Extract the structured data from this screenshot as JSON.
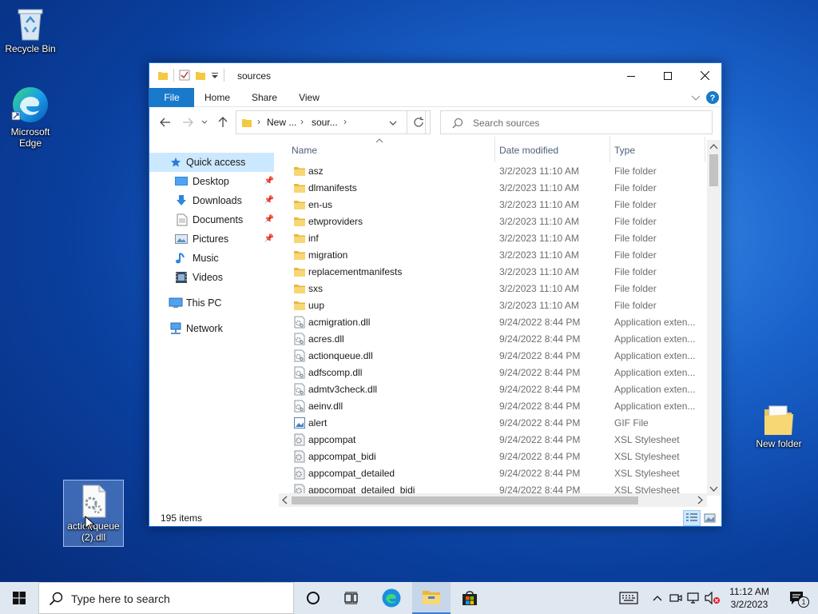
{
  "desktop": {
    "icons": [
      {
        "label": "Recycle Bin",
        "icon": "recycle-bin-icon"
      },
      {
        "label": "Microsoft Edge",
        "icon": "edge-icon"
      },
      {
        "label": "New folder",
        "icon": "folder-icon"
      },
      {
        "label": "actionqueue (2).dll",
        "icon": "dll-file-icon"
      }
    ]
  },
  "window": {
    "title": "sources",
    "ribbon_tabs": [
      "File",
      "Home",
      "Share",
      "View"
    ],
    "address": {
      "crumb1": "New ...",
      "crumb2": "sour...",
      "sep": "›"
    },
    "search": {
      "placeholder": "Search sources"
    },
    "nav_pane": [
      {
        "label": "Quick access",
        "icon": "star-icon",
        "selected": true,
        "pinned": false
      },
      {
        "label": "Desktop",
        "icon": "desktop-icon",
        "pinned": true
      },
      {
        "label": "Downloads",
        "icon": "downloads-icon",
        "pinned": true
      },
      {
        "label": "Documents",
        "icon": "documents-icon",
        "pinned": true
      },
      {
        "label": "Pictures",
        "icon": "pictures-icon",
        "pinned": true
      },
      {
        "label": "Music",
        "icon": "music-icon",
        "pinned": false
      },
      {
        "label": "Videos",
        "icon": "videos-icon",
        "pinned": false
      },
      {
        "label": "This PC",
        "icon": "this-pc-icon",
        "pinned": false
      },
      {
        "label": "Network",
        "icon": "network-icon",
        "pinned": false
      }
    ],
    "columns": {
      "name": "Name",
      "date": "Date modified",
      "type": "Type"
    },
    "files": [
      {
        "name": "asz",
        "date": "3/2/2023 11:10 AM",
        "type": "File folder",
        "kind": "folder"
      },
      {
        "name": "dlmanifests",
        "date": "3/2/2023 11:10 AM",
        "type": "File folder",
        "kind": "folder"
      },
      {
        "name": "en-us",
        "date": "3/2/2023 11:10 AM",
        "type": "File folder",
        "kind": "folder"
      },
      {
        "name": "etwproviders",
        "date": "3/2/2023 11:10 AM",
        "type": "File folder",
        "kind": "folder"
      },
      {
        "name": "inf",
        "date": "3/2/2023 11:10 AM",
        "type": "File folder",
        "kind": "folder"
      },
      {
        "name": "migration",
        "date": "3/2/2023 11:10 AM",
        "type": "File folder",
        "kind": "folder"
      },
      {
        "name": "replacementmanifests",
        "date": "3/2/2023 11:10 AM",
        "type": "File folder",
        "kind": "folder"
      },
      {
        "name": "sxs",
        "date": "3/2/2023 11:10 AM",
        "type": "File folder",
        "kind": "folder"
      },
      {
        "name": "uup",
        "date": "3/2/2023 11:10 AM",
        "type": "File folder",
        "kind": "folder"
      },
      {
        "name": "acmigration.dll",
        "date": "9/24/2022 8:44 PM",
        "type": "Application exten...",
        "kind": "dll"
      },
      {
        "name": "acres.dll",
        "date": "9/24/2022 8:44 PM",
        "type": "Application exten...",
        "kind": "dll"
      },
      {
        "name": "actionqueue.dll",
        "date": "9/24/2022 8:44 PM",
        "type": "Application exten...",
        "kind": "dll"
      },
      {
        "name": "adfscomp.dll",
        "date": "9/24/2022 8:44 PM",
        "type": "Application exten...",
        "kind": "dll"
      },
      {
        "name": "admtv3check.dll",
        "date": "9/24/2022 8:44 PM",
        "type": "Application exten...",
        "kind": "dll"
      },
      {
        "name": "aeinv.dll",
        "date": "9/24/2022 8:44 PM",
        "type": "Application exten...",
        "kind": "dll"
      },
      {
        "name": "alert",
        "date": "9/24/2022 8:44 PM",
        "type": "GIF File",
        "kind": "gif"
      },
      {
        "name": "appcompat",
        "date": "9/24/2022 8:44 PM",
        "type": "XSL Stylesheet",
        "kind": "xsl"
      },
      {
        "name": "appcompat_bidi",
        "date": "9/24/2022 8:44 PM",
        "type": "XSL Stylesheet",
        "kind": "xsl"
      },
      {
        "name": "appcompat_detailed",
        "date": "9/24/2022 8:44 PM",
        "type": "XSL Stylesheet",
        "kind": "xsl"
      },
      {
        "name": "appcompat_detailed_bidi",
        "date": "9/24/2022 8:44 PM",
        "type": "XSL Stylesheet",
        "kind": "xsl"
      }
    ],
    "status": {
      "item_count": "195 items"
    }
  },
  "taskbar": {
    "search_placeholder": "Type here to search",
    "clock": {
      "time": "11:12 AM",
      "date": "3/2/2023"
    },
    "notification_count": "1"
  },
  "colors": {
    "accent": "#1979ca",
    "selection": "#cce8ff",
    "folder": "#f5c842"
  }
}
